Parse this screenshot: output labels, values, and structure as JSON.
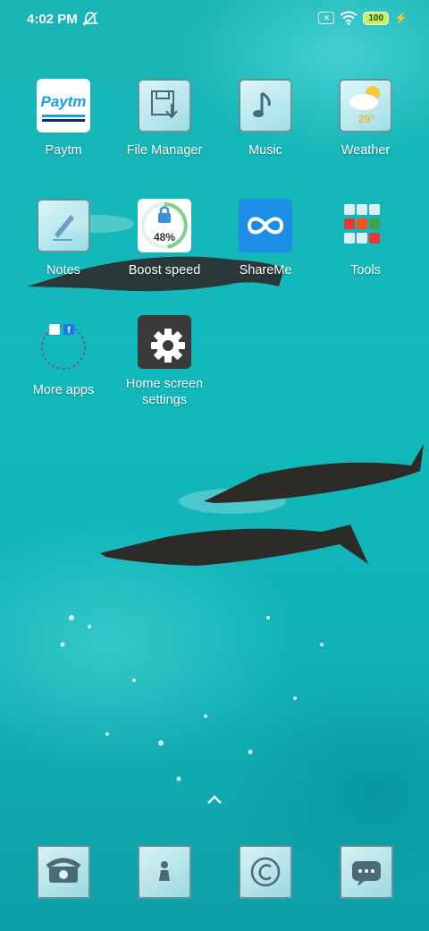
{
  "status_bar": {
    "time": "4:02 PM",
    "battery": "100",
    "icons": [
      "bell-off-icon",
      "sim-off-icon",
      "wifi-icon",
      "battery-icon",
      "charging-icon"
    ]
  },
  "apps": [
    {
      "label": "Paytm",
      "icon": "paytm-icon"
    },
    {
      "label": "File Manager",
      "icon": "file-manager-icon"
    },
    {
      "label": "Music",
      "icon": "music-icon"
    },
    {
      "label": "Weather",
      "icon": "weather-icon",
      "temp": "29°"
    },
    {
      "label": "Notes",
      "icon": "notes-icon"
    },
    {
      "label": "Boost speed",
      "icon": "boost-speed-icon",
      "percent": "48%"
    },
    {
      "label": "ShareMe",
      "icon": "shareme-icon"
    },
    {
      "label": "Tools",
      "icon": "tools-folder-icon"
    },
    {
      "label": "More apps",
      "icon": "more-apps-folder-icon"
    },
    {
      "label": "Home screen settings",
      "icon": "gear-icon"
    }
  ],
  "paytm_logo": {
    "pay": "Pay",
    "tm": "tm"
  },
  "dock": [
    {
      "icon": "phone-icon"
    },
    {
      "icon": "contacts-icon"
    },
    {
      "icon": "browser-icon"
    },
    {
      "icon": "messages-icon"
    }
  ],
  "colors": {
    "water": "#12b9bb",
    "shareme": "#1e8de8",
    "battery": "#c8f05a",
    "paytm_navy": "#0b2f6b",
    "paytm_blue": "#1aa1e0"
  }
}
